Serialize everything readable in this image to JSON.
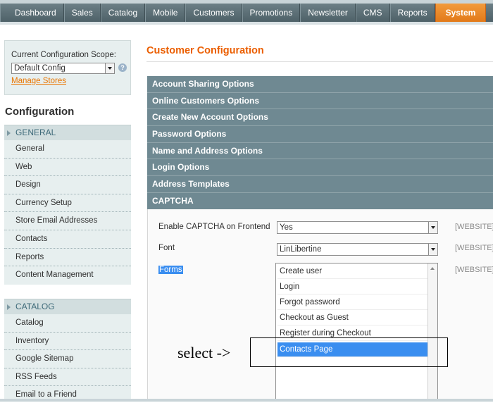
{
  "nav": {
    "items": [
      "Dashboard",
      "Sales",
      "Catalog",
      "Mobile",
      "Customers",
      "Promotions",
      "Newsletter",
      "CMS",
      "Reports",
      "System"
    ],
    "active": "System"
  },
  "scope": {
    "label": "Current Configuration Scope:",
    "value": "Default Config",
    "manage_link": "Manage Stores",
    "help_icon": "help-icon"
  },
  "sidebar": {
    "title": "Configuration",
    "general": {
      "header": "GENERAL",
      "items": [
        "General",
        "Web",
        "Design",
        "Currency Setup",
        "Store Email Addresses",
        "Contacts",
        "Reports",
        "Content Management"
      ]
    },
    "catalog": {
      "header": "CATALOG",
      "items": [
        "Catalog",
        "Inventory",
        "Google Sitemap",
        "RSS Feeds",
        "Email to a Friend"
      ]
    }
  },
  "main": {
    "title": "Customer Configuration",
    "sections": [
      "Account Sharing Options",
      "Online Customers Options",
      "Create New Account Options",
      "Password Options",
      "Name and Address Options",
      "Login Options",
      "Address Templates",
      "CAPTCHA"
    ],
    "captcha": {
      "enable_label": "Enable CAPTCHA on Frontend",
      "enable_value": "Yes",
      "font_label": "Font",
      "font_value": "LinLibertine",
      "forms_label": "Forms",
      "scope_tag": "[WEBSITE]",
      "forms_options": [
        "Create user",
        "Login",
        "Forgot password",
        "Checkout as Guest",
        "Register during Checkout",
        "Contacts Page"
      ],
      "selected_option": "Contacts Page"
    }
  },
  "annotation": {
    "text": "select ->"
  },
  "colors": {
    "nav_bg": "#5a6d74",
    "nav_active": "#ea7c1c",
    "section_bar": "#6f8992",
    "title_orange": "#eb5e00",
    "link_orange": "#ea7601",
    "selection_blue": "#3a8ef0"
  }
}
